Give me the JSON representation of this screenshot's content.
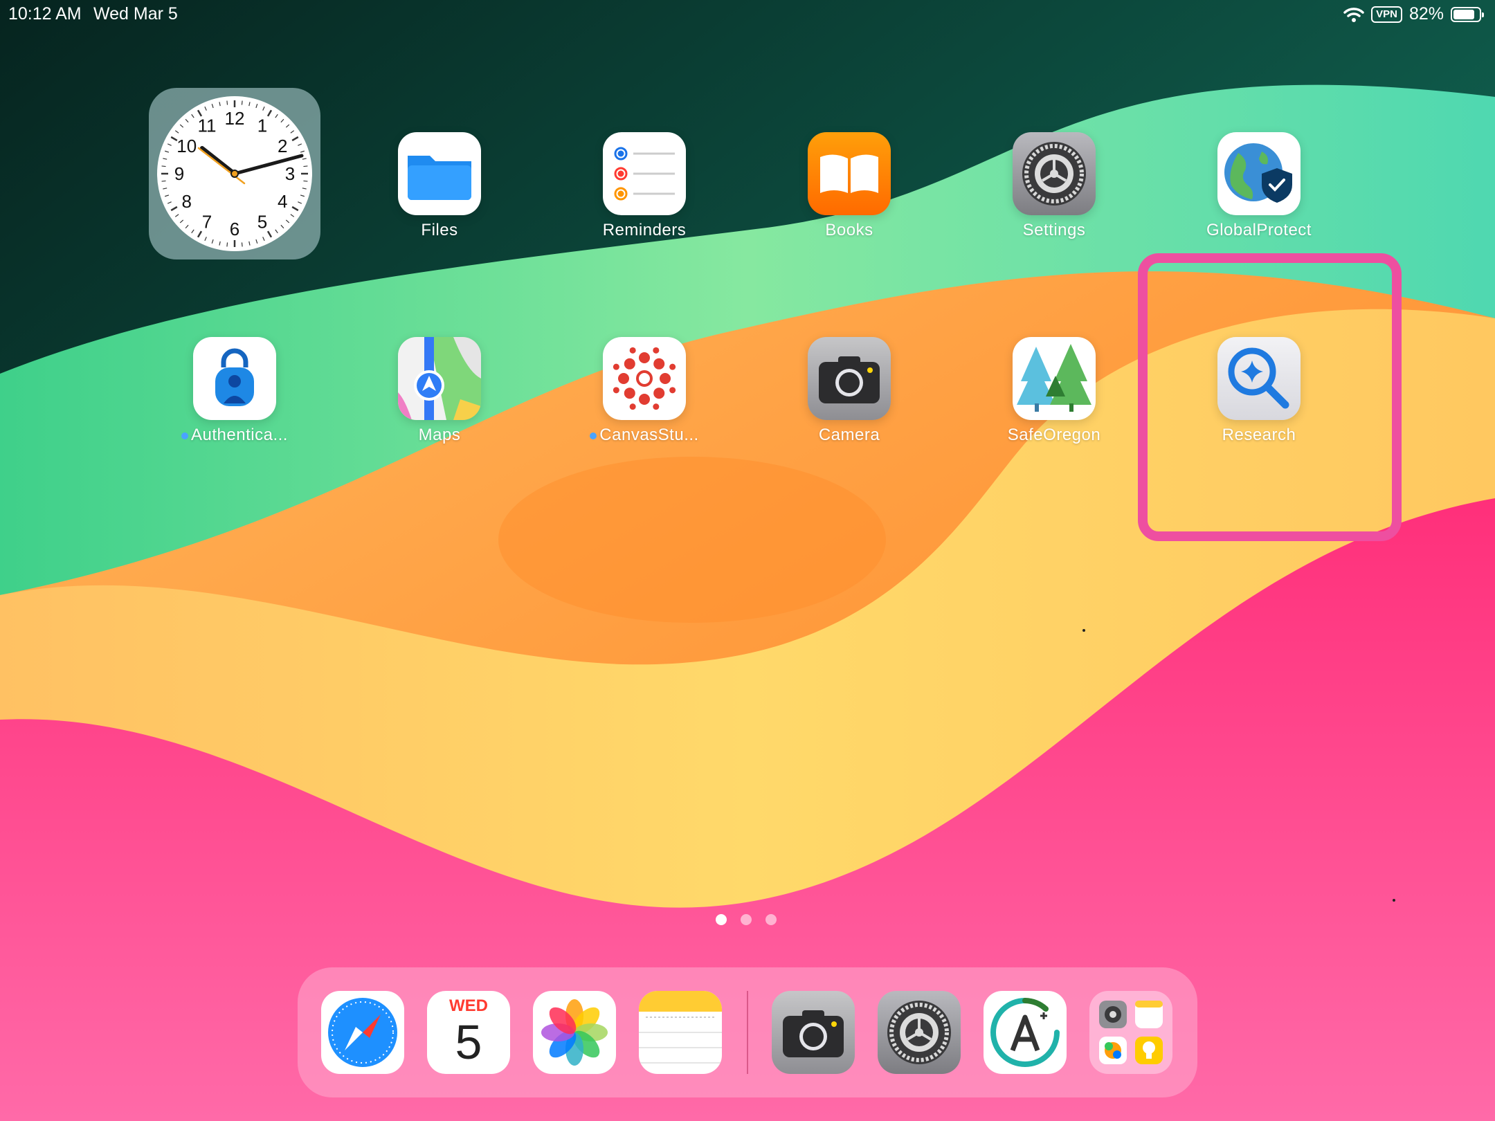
{
  "status_bar": {
    "time": "10:12 AM",
    "date": "Wed Mar 5",
    "vpn": "VPN",
    "battery": "82%",
    "battery_level": 0.82
  },
  "clock_widget": {
    "numbers": [
      "12",
      "1",
      "2",
      "3",
      "4",
      "5",
      "6",
      "7",
      "8",
      "9",
      "10",
      "11"
    ]
  },
  "apps": [
    {
      "label": "Files",
      "icon": "files-icon"
    },
    {
      "label": "Reminders",
      "icon": "reminders-icon"
    },
    {
      "label": "Books",
      "icon": "books-icon"
    },
    {
      "label": "Settings",
      "icon": "settings-icon"
    },
    {
      "label": "GlobalProtect",
      "icon": "globalprotect-icon"
    },
    {
      "label": "Authentica...",
      "icon": "authenticator-icon"
    },
    {
      "label": "Maps",
      "icon": "maps-icon"
    },
    {
      "label": "CanvasStu...",
      "icon": "canvas-student-icon"
    },
    {
      "label": "Camera",
      "icon": "camera-icon"
    },
    {
      "label": "SafeOregon",
      "icon": "safeoregon-icon"
    },
    {
      "label": "Research",
      "icon": "research-icon"
    }
  ],
  "dock": {
    "calendar_day": "WED",
    "calendar_date": "5",
    "apps": [
      "safari-icon",
      "calendar-icon",
      "photos-icon",
      "notes-icon",
      "camera-icon",
      "settings-icon",
      "translate-icon",
      "app-library-icon"
    ]
  },
  "page_indicator": {
    "pages": 3,
    "current": 1
  }
}
